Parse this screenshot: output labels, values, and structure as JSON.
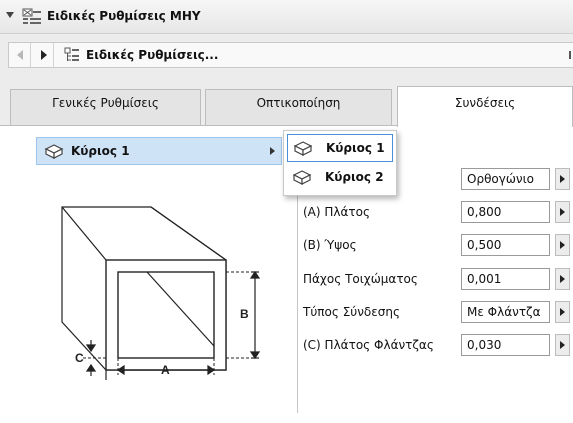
{
  "panel": {
    "title": "Ειδικές Ρυθμίσεις ΜΗΥ",
    "icon": "settings-panel-icon"
  },
  "toolbar": {
    "title": "Ειδικές Ρυθμίσεις...",
    "prev_icon": "triangle-left-icon",
    "next_icon": "triangle-right-icon",
    "icon": "settings-tree-icon"
  },
  "tabs": [
    {
      "label": "Γενικές Ρυθμίσεις",
      "active": false
    },
    {
      "label": "Οπτικοποίηση",
      "active": false
    },
    {
      "label": "Συνδέσεις",
      "active": true
    }
  ],
  "connection": {
    "selected": "Κύριος 1",
    "options": [
      "Κύριος 1",
      "Κύριος 2"
    ],
    "icon": "box-connector-icon"
  },
  "diagram": {
    "label_a": "A",
    "label_b": "B",
    "label_c": "C"
  },
  "properties": {
    "shape": {
      "value": "Ορθογώνιο"
    },
    "width": {
      "label": "(A) Πλάτος",
      "value": "0,800"
    },
    "height": {
      "label": "(B) Ύψος",
      "value": "0,500"
    },
    "wall_thickness": {
      "label": "Πάχος Τοιχώματος",
      "value": "0,001"
    },
    "connection_type": {
      "label": "Τύπος Σύνδεσης",
      "value": "Με Φλάντζα"
    },
    "flange_width": {
      "label": "(C) Πλάτος Φλάντζας",
      "value": "0,030"
    }
  },
  "colors": {
    "selection_bg": "#cfe3f7",
    "selection_border": "#9ec5eb",
    "popup_focus": "#4a90d9"
  }
}
